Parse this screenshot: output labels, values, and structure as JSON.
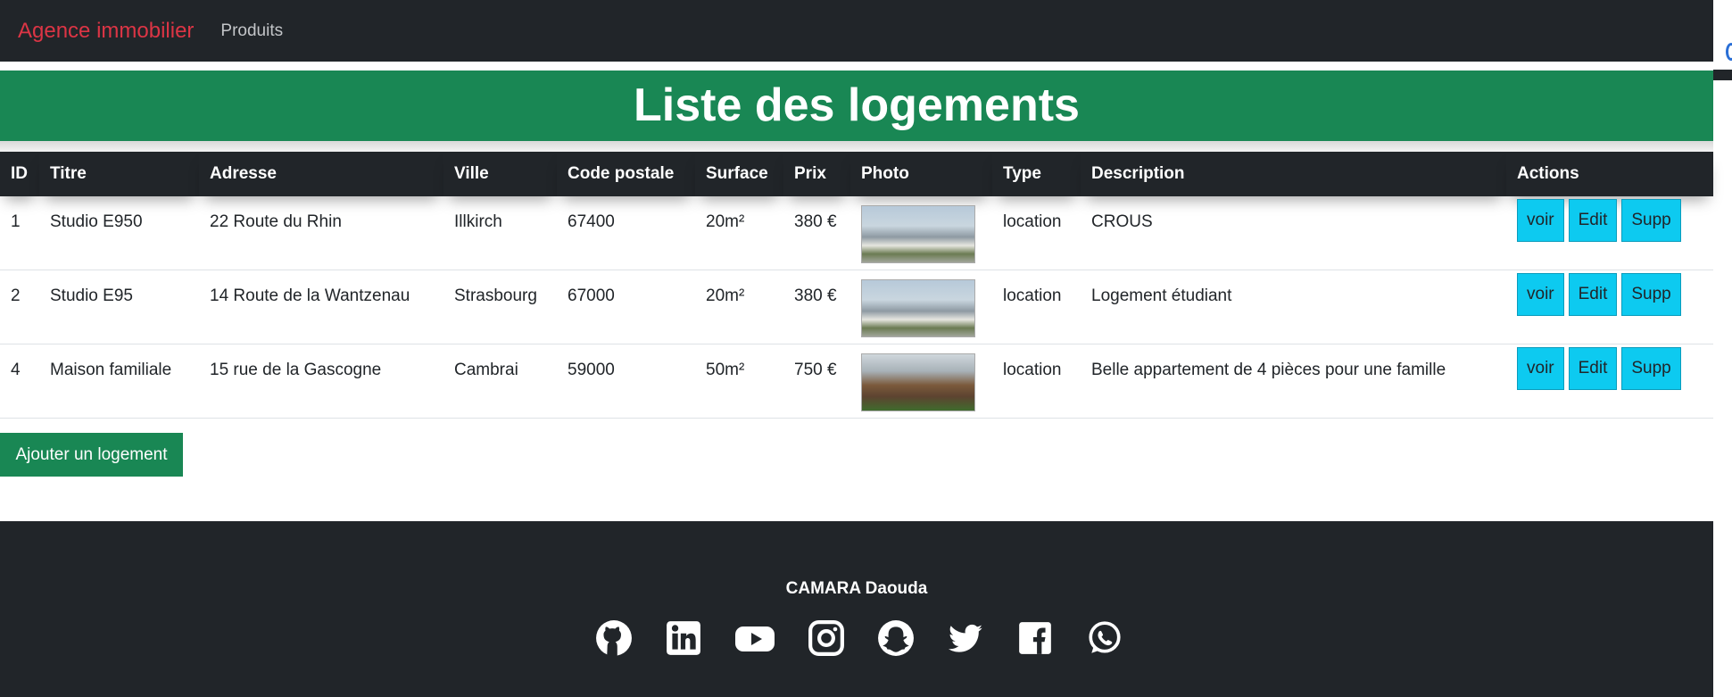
{
  "navbar": {
    "brand": "Agence immobilier",
    "link": "Produits"
  },
  "banner": {
    "title": "Liste des logements"
  },
  "table": {
    "headers": [
      "ID",
      "Titre",
      "Adresse",
      "Ville",
      "Code postale",
      "Surface",
      "Prix",
      "Photo",
      "Type",
      "Description",
      "Actions"
    ],
    "rows": [
      {
        "id": "1",
        "titre": "Studio E950",
        "adresse": "22 Route du Rhin",
        "ville": "Illkirch",
        "code": "67400",
        "surface": "20m²",
        "prix": "380 €",
        "type": "location",
        "description": "CROUS"
      },
      {
        "id": "2",
        "titre": "Studio E95",
        "adresse": "14 Route de la Wantzenau",
        "ville": "Strasbourg",
        "code": "67000",
        "surface": "20m²",
        "prix": "380 €",
        "type": "location",
        "description": "Logement étudiant"
      },
      {
        "id": "4",
        "titre": "Maison familiale",
        "adresse": "15 rue de la Gascogne",
        "ville": "Cambrai",
        "code": "59000",
        "surface": "50m²",
        "prix": "750 €",
        "type": "location",
        "description": "Belle appartement de 4 pièces pour une famille"
      }
    ],
    "actions": {
      "view": "voir",
      "edit": "Edit",
      "delete": "Supp"
    }
  },
  "add_button": "Ajouter un logement",
  "footer": {
    "author": "CAMARA Daouda",
    "social_icons": [
      "github-icon",
      "linkedin-icon",
      "youtube-icon",
      "instagram-icon",
      "snapchat-icon",
      "twitter-icon",
      "facebook-icon",
      "whatsapp-icon"
    ]
  },
  "colors": {
    "dark": "#212529",
    "brand": "#dc3545",
    "green": "#198754",
    "cyan": "#0dcaf0"
  }
}
